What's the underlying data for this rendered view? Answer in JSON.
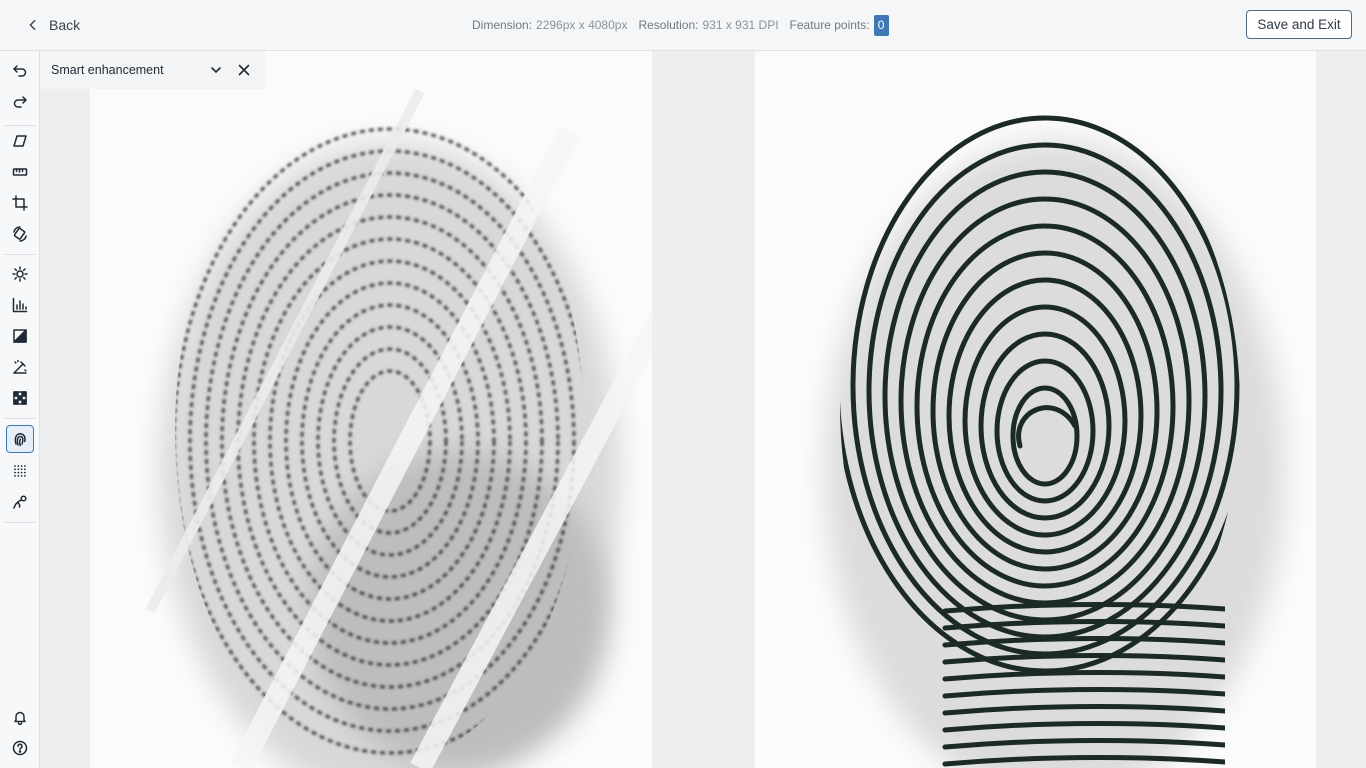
{
  "header": {
    "back_label": "Back",
    "dimension_label": "Dimension:",
    "dimension_value": "2296px x 4080px",
    "resolution_label": "Resolution:",
    "resolution_value": "931 x 931 DPI",
    "feature_points_label": "Feature points:",
    "feature_points_value": "0",
    "save_exit_label": "Save and Exit"
  },
  "panel": {
    "title": "Smart enhancement"
  },
  "toolbar": {
    "tools": [
      "undo-icon",
      "redo-icon",
      "perspective-icon",
      "ruler-icon",
      "crop-icon",
      "rotate-icon",
      "brightness-icon",
      "histogram-icon",
      "contrast-icon",
      "auto-fix-icon",
      "pattern-icon",
      "fingerprint-icon",
      "dots-grid-icon",
      "curve-icon"
    ],
    "active_tool": "fingerprint-icon",
    "bottom_tools": [
      "bell-icon",
      "help-icon"
    ]
  },
  "colors": {
    "accent": "#3f78b5",
    "ridge_dark": "#1b2a27",
    "latent": "#2a2a2a"
  }
}
